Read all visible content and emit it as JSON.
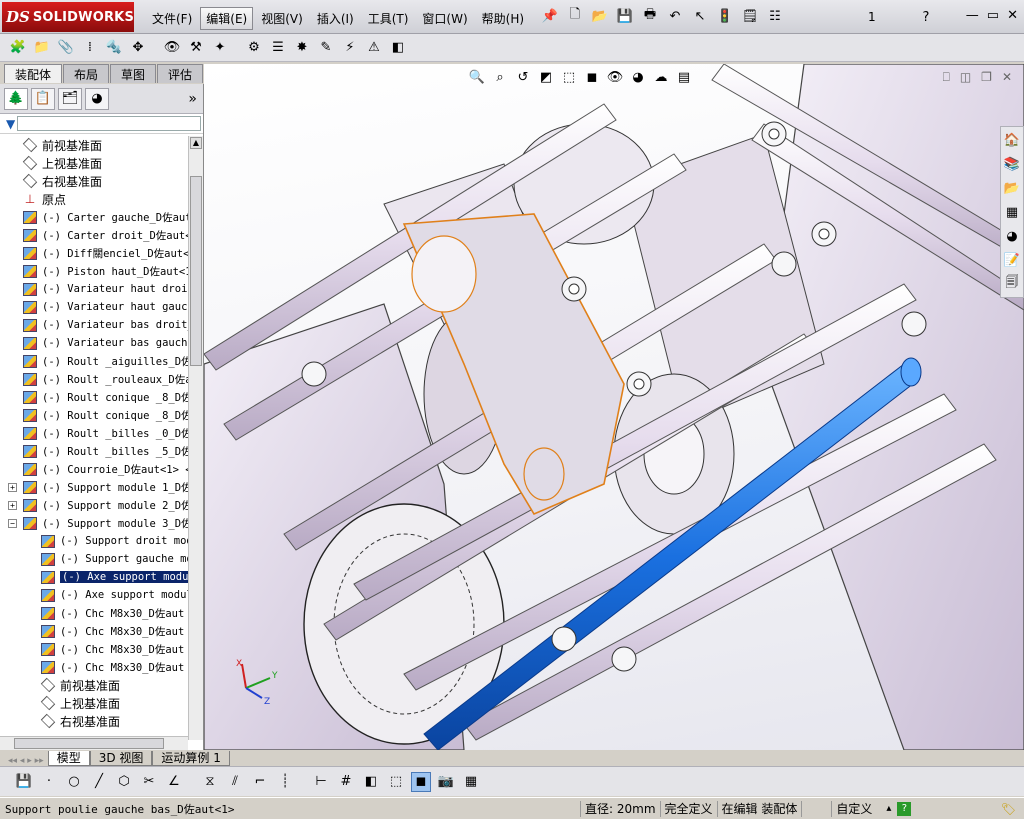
{
  "app": {
    "logo_prefix": "DS",
    "logo_name": "SOLIDWORKS"
  },
  "menu": [
    "文件(F)",
    "编辑(E)",
    "视图(V)",
    "插入(I)",
    "工具(T)",
    "窗口(W)",
    "帮助(H)"
  ],
  "menu_active_index": 1,
  "top_toolbar": {
    "config_count": "1",
    "help_icon": "?"
  },
  "window_controls": [
    "—",
    "▭",
    "✕"
  ],
  "command_tabs": [
    "装配体",
    "布局",
    "草图",
    "评估"
  ],
  "fm_tabs_more": "»",
  "tree": [
    {
      "label": "前视基准面",
      "icon": "plane",
      "level": 1
    },
    {
      "label": "上视基准面",
      "icon": "plane",
      "level": 1
    },
    {
      "label": "右视基准面",
      "icon": "plane",
      "level": 1
    },
    {
      "label": "原点",
      "icon": "origin",
      "level": 1
    },
    {
      "label": "(-) Carter gauche_D佐aut<",
      "icon": "part",
      "level": 1
    },
    {
      "label": "(-) Carter droit_D佐aut<",
      "icon": "part",
      "level": 1
    },
    {
      "label": "(-) Diff關enciel_D佐aut<",
      "icon": "part",
      "level": 1
    },
    {
      "label": "(-) Piston haut_D佐aut<1",
      "icon": "part",
      "level": 1
    },
    {
      "label": "(-) Variateur haut droit",
      "icon": "part",
      "level": 1
    },
    {
      "label": "(-) Variateur haut gauch",
      "icon": "part",
      "level": 1
    },
    {
      "label": "(-) Variateur bas droit_",
      "icon": "part",
      "level": 1
    },
    {
      "label": "(-) Variateur bas gauche",
      "icon": "part",
      "level": 1
    },
    {
      "label": "(-) Roult _aiguilles_D佐",
      "icon": "part",
      "level": 1
    },
    {
      "label": "(-) Roult _rouleaux_D佐a",
      "icon": "part",
      "level": 1
    },
    {
      "label": "(-) Roult conique _8_D佐",
      "icon": "part",
      "level": 1
    },
    {
      "label": "(-) Roult conique _8_D佐",
      "icon": "part",
      "level": 1
    },
    {
      "label": "(-) Roult _billes _0_D佐",
      "icon": "part",
      "level": 1
    },
    {
      "label": "(-) Roult _billes _5_D佐",
      "icon": "part",
      "level": 1
    },
    {
      "label": "(-) Courroie_D佐aut<1> <",
      "icon": "part",
      "level": 1
    },
    {
      "label": "(-) Support module 1_D佐",
      "icon": "part",
      "level": 1,
      "expander": "+"
    },
    {
      "label": "(-) Support module 2_D佐",
      "icon": "part",
      "level": 1,
      "expander": "+"
    },
    {
      "label": "(-) Support module 3_D佐",
      "icon": "part",
      "level": 1,
      "expander": "−"
    },
    {
      "label": "(-) Support droit mod",
      "icon": "part",
      "level": 2
    },
    {
      "label": "(-) Support gauche mo",
      "icon": "part",
      "level": 2
    },
    {
      "label": "(-) Axe support modu",
      "icon": "part",
      "level": 2,
      "selected": true
    },
    {
      "label": "(-) Axe support modul",
      "icon": "part",
      "level": 2
    },
    {
      "label": "(-) Chc M8x30_D佐aut",
      "icon": "part",
      "level": 2
    },
    {
      "label": "(-) Chc M8x30_D佐aut",
      "icon": "part",
      "level": 2
    },
    {
      "label": "(-) Chc M8x30_D佐aut",
      "icon": "part",
      "level": 2
    },
    {
      "label": "(-) Chc M8x30_D佐aut",
      "icon": "part",
      "level": 2
    },
    {
      "label": "前视基准面",
      "icon": "plane",
      "level": 2
    },
    {
      "label": "上视基准面",
      "icon": "plane",
      "level": 2
    },
    {
      "label": "右视基准面",
      "icon": "plane",
      "level": 2
    }
  ],
  "bottom_tabs": [
    "模型",
    "3D 视图",
    "运动算例 1"
  ],
  "bottom_tab_active_index": 0,
  "triad": {
    "x": "X",
    "y": "Y",
    "z": "Z"
  },
  "status": {
    "message": "Support poulie gauche bas_D佐aut<1>",
    "diameter": "直径: 20mm",
    "definition": "完全定义",
    "editing": "在编辑 装配体",
    "units": "自定义",
    "units_arrow": "▴",
    "help": "?"
  },
  "colors": {
    "selection": "#0a246a",
    "highlight_part": "#1a70e0",
    "edge_orange": "#e0801a",
    "title_red": "#c01818"
  }
}
